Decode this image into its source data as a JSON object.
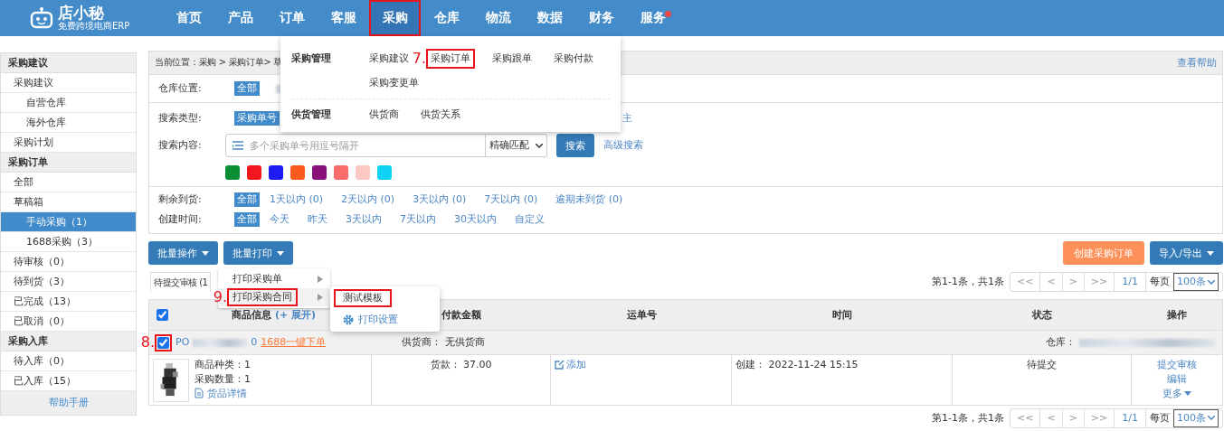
{
  "header": {
    "logo": {
      "name": "店小秘",
      "tagline": "免费跨境电商ERP"
    },
    "nav": [
      {
        "label": "首页",
        "selected": false,
        "highlight": false,
        "dot": false
      },
      {
        "label": "产品",
        "selected": false,
        "highlight": false,
        "dot": false
      },
      {
        "label": "订单",
        "selected": false,
        "highlight": false,
        "dot": false
      },
      {
        "label": "客服",
        "selected": false,
        "highlight": false,
        "dot": false
      },
      {
        "label": "采购",
        "selected": true,
        "highlight": true,
        "dot": false
      },
      {
        "label": "仓库",
        "selected": false,
        "highlight": false,
        "dot": false
      },
      {
        "label": "物流",
        "selected": false,
        "highlight": false,
        "dot": false
      },
      {
        "label": "数据",
        "selected": false,
        "highlight": false,
        "dot": false
      },
      {
        "label": "财务",
        "selected": false,
        "highlight": false,
        "dot": false
      },
      {
        "label": "服务",
        "selected": false,
        "highlight": false,
        "dot": true
      }
    ]
  },
  "nav_menu": {
    "groups": [
      {
        "title": "采购管理",
        "items": [
          {
            "label": "采购建议",
            "highlight": false
          },
          {
            "label": "采购订单",
            "highlight": true,
            "annotation": "7."
          },
          {
            "label": "采购跟单",
            "highlight": false
          },
          {
            "label": "采购付款",
            "highlight": false
          },
          {
            "label": "采购变更单",
            "highlight": false
          }
        ]
      },
      {
        "title": "供货管理",
        "items": [
          {
            "label": "供货商",
            "highlight": false
          },
          {
            "label": "供货关系",
            "highlight": false
          }
        ]
      }
    ]
  },
  "sidebar": {
    "sections": [
      {
        "title": "采购建议",
        "items": [
          {
            "label": "采购建议",
            "selected": false,
            "children": [
              {
                "label": "自营仓库",
                "selected": false
              },
              {
                "label": "海外仓库",
                "selected": false
              }
            ]
          },
          {
            "label": "采购计划",
            "selected": false
          }
        ]
      },
      {
        "title": "采购订单",
        "items": [
          {
            "label": "全部",
            "selected": false
          },
          {
            "label": "草稿箱",
            "selected": false,
            "children": [
              {
                "label": "手动采购（1）",
                "selected": true
              },
              {
                "label": "1688采购（3）",
                "selected": false
              }
            ]
          },
          {
            "label": "待审核（0）",
            "selected": false
          },
          {
            "label": "待到货（3）",
            "selected": false
          },
          {
            "label": "已完成（13）",
            "selected": false
          },
          {
            "label": "已取消（0）",
            "selected": false
          }
        ]
      },
      {
        "title": "采购入库",
        "items": [
          {
            "label": "待入库（0）",
            "selected": false
          },
          {
            "label": "已入库（15）",
            "selected": false
          }
        ]
      }
    ],
    "footer": "帮助手册"
  },
  "breadcrumb": "当前位置：采购 > 采购订单> 草",
  "help_link": "查看帮助",
  "filters": {
    "warehouse": {
      "label": "仓库位置:",
      "options": [
        {
          "label": "全部",
          "selected": true
        }
      ]
    },
    "search_type": {
      "label": "搜索类型:",
      "options": [
        {
          "label": "采购单号",
          "selected": true
        },
        {
          "label": "主",
          "selected": false
        }
      ]
    },
    "search_content": {
      "label": "搜索内容:",
      "placeholder": "多个采购单号用逗号隔开",
      "match": "精确匹配",
      "button": "搜索",
      "advanced": "高级搜索",
      "colors": [
        {
          "color": "#0a8f34"
        },
        {
          "color": "#f2171d"
        },
        {
          "color": "#1d1cf2"
        },
        {
          "color": "#fb5a1f"
        },
        {
          "color": "#87107a"
        },
        {
          "color": "#fb6c6c"
        },
        {
          "color": "#fdc8c4"
        },
        {
          "color": "#0fd2f5"
        }
      ]
    },
    "remaining": {
      "label": "剩余到货:",
      "options": [
        {
          "label": "全部",
          "selected": true
        },
        {
          "label": "1天以内 (0)",
          "selected": false
        },
        {
          "label": "2天以内 (0)",
          "selected": false
        },
        {
          "label": "3天以内 (0)",
          "selected": false
        },
        {
          "label": "7天以内 (0)",
          "selected": false
        },
        {
          "label": "逾期未到货 (0)",
          "selected": false
        }
      ]
    },
    "created": {
      "label": "创建时间:",
      "options": [
        {
          "label": "全部",
          "selected": true
        },
        {
          "label": "今天",
          "selected": false
        },
        {
          "label": "昨天",
          "selected": false
        },
        {
          "label": "3天以内",
          "selected": false
        },
        {
          "label": "7天以内",
          "selected": false
        },
        {
          "label": "30天以内",
          "selected": false
        },
        {
          "label": "自定义",
          "selected": false
        }
      ]
    }
  },
  "toolbar": {
    "left": [
      "批量操作",
      "批量打印"
    ],
    "create": "创建采购订单",
    "import_export": "导入/导出"
  },
  "print_menu": {
    "items": [
      {
        "label": "打印采购单",
        "highlight": false
      },
      {
        "label": "打印采购合同",
        "highlight": true,
        "annotation": "9."
      }
    ],
    "submenu": [
      {
        "kind": "template",
        "label": "测试模板",
        "highlight": true
      },
      {
        "kind": "settings",
        "label": "打印设置",
        "highlight": false
      }
    ]
  },
  "tabs": [
    {
      "label": "待提交审核 (1",
      "selected": true
    }
  ],
  "pagination_top": {
    "summary": "第1-1条，共1条",
    "buttons": [
      "<<",
      "<",
      ">",
      ">>"
    ],
    "page": "1/1",
    "per_page": "每页",
    "size": "100条"
  },
  "table": {
    "all_checked": true,
    "columns": [
      {
        "label": "商品信息",
        "extra": "(+ 展开)"
      },
      {
        "label": "付款金额"
      },
      {
        "label": "运单号"
      },
      {
        "label": "时间"
      },
      {
        "label": "状态"
      },
      {
        "label": "操作"
      }
    ],
    "orders": [
      {
        "checked": true,
        "highlight": true,
        "annotation": "8.",
        "number_start": "PO",
        "number_end": "0",
        "quick_order": "1688一键下单",
        "supplier": "供货商：  无供货商",
        "warehouse": "仓库：",
        "product_types": "商品种类：1",
        "quantity": "采购数量：1",
        "details": "货品详情",
        "payment": "货款：  37.00",
        "waybill_action": "添加",
        "created": "创建：  2022-11-24 15:15",
        "status": "待提交",
        "actions": [
          {
            "label": "提交审核",
            "caret": false
          },
          {
            "label": "编辑",
            "caret": false
          },
          {
            "label": "更多",
            "caret": true
          }
        ]
      }
    ]
  },
  "pagination_bottom": {
    "summary": "第1-1条，共1条",
    "buttons": [
      "<<",
      "<",
      ">",
      ">>"
    ],
    "page": "1/1",
    "per_page": "每页",
    "size": "100条"
  }
}
